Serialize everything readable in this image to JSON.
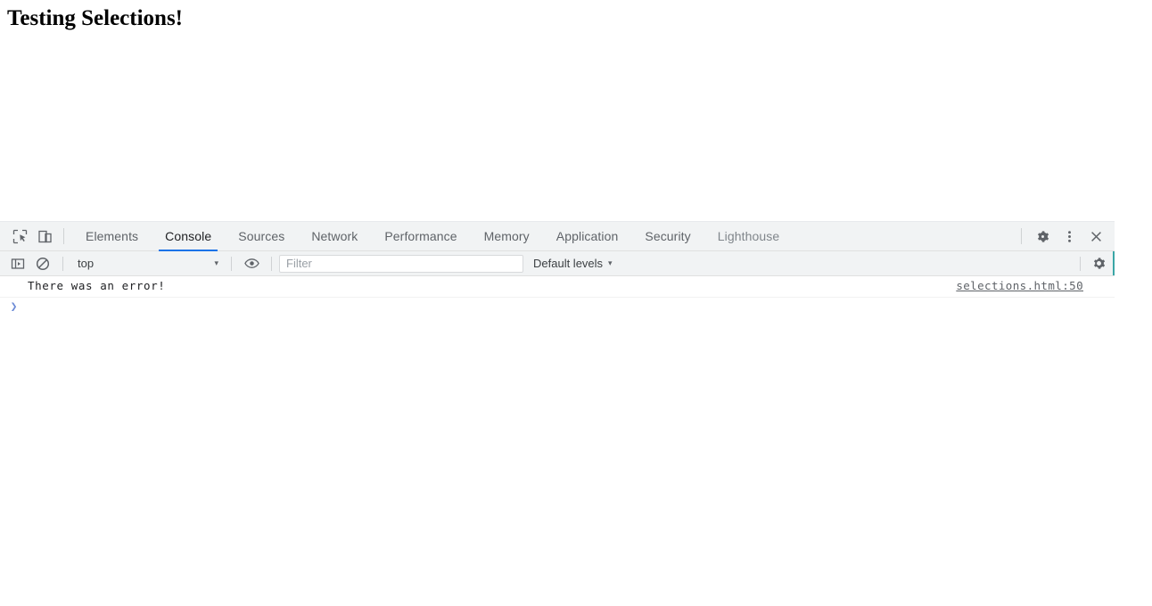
{
  "page": {
    "heading": "Testing Selections!"
  },
  "devtools": {
    "toolbar": {
      "inspect_icon": "inspect-element-icon",
      "device_icon": "device-toolbar-icon",
      "settings_icon": "gear-icon",
      "more_icon": "kebab-menu-icon",
      "close_icon": "close-icon"
    },
    "tabs": [
      {
        "label": "Elements",
        "active": false,
        "muted": false
      },
      {
        "label": "Console",
        "active": true,
        "muted": false
      },
      {
        "label": "Sources",
        "active": false,
        "muted": false
      },
      {
        "label": "Network",
        "active": false,
        "muted": false
      },
      {
        "label": "Performance",
        "active": false,
        "muted": false
      },
      {
        "label": "Memory",
        "active": false,
        "muted": false
      },
      {
        "label": "Application",
        "active": false,
        "muted": false
      },
      {
        "label": "Security",
        "active": false,
        "muted": false
      },
      {
        "label": "Lighthouse",
        "active": false,
        "muted": true
      }
    ],
    "filterbar": {
      "sidebar_icon": "console-sidebar-icon",
      "clear_icon": "clear-console-icon",
      "context": "top",
      "context_caret": "▾",
      "eye_icon": "live-expression-eye-icon",
      "filter_value": "",
      "filter_placeholder": "Filter",
      "levels": "Default levels",
      "levels_caret": "▾",
      "settings_icon": "gear-icon"
    },
    "console": {
      "messages": [
        {
          "text": "There was an error!",
          "source": "selections.html:50"
        }
      ],
      "prompt_caret": "❯",
      "prompt_value": ""
    }
  }
}
